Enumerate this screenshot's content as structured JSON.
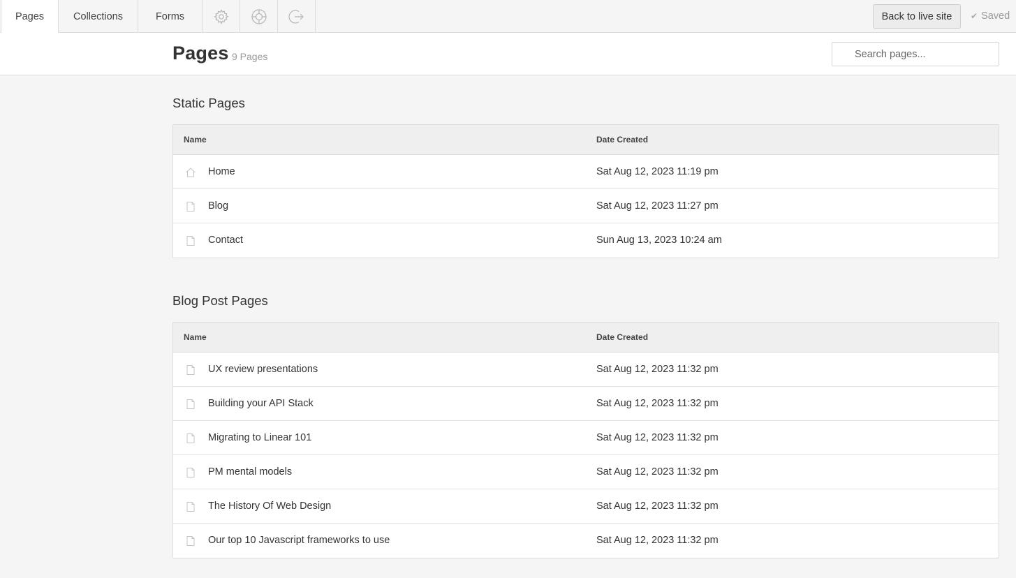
{
  "topbar": {
    "tabs": [
      {
        "label": "Pages",
        "active": true
      },
      {
        "label": "Collections",
        "active": false
      },
      {
        "label": "Forms",
        "active": false
      }
    ],
    "icon_tabs": [
      "gear-icon",
      "lifebuoy-icon",
      "logout-icon"
    ],
    "back_button": "Back to live site",
    "saved_label": "Saved"
  },
  "header": {
    "title": "Pages",
    "count": "9 Pages",
    "search_placeholder": "Search pages..."
  },
  "static_pages": {
    "title": "Static Pages",
    "col_name": "Name",
    "col_date": "Date Created",
    "rows": [
      {
        "name": "Home",
        "date": "Sat Aug 12, 2023 11:19 pm",
        "icon": "home-icon"
      },
      {
        "name": "Blog",
        "date": "Sat Aug 12, 2023 11:27 pm",
        "icon": "page-icon"
      },
      {
        "name": "Contact",
        "date": "Sun Aug 13, 2023 10:24 am",
        "icon": "page-icon"
      }
    ]
  },
  "blog_pages": {
    "title": "Blog Post Pages",
    "col_name": "Name",
    "col_date": "Date Created",
    "rows": [
      {
        "name": "UX review presentations",
        "date": "Sat Aug 12, 2023 11:32 pm",
        "icon": "page-icon"
      },
      {
        "name": "Building your API Stack",
        "date": "Sat Aug 12, 2023 11:32 pm",
        "icon": "page-icon"
      },
      {
        "name": "Migrating to Linear 101",
        "date": "Sat Aug 12, 2023 11:32 pm",
        "icon": "page-icon"
      },
      {
        "name": "PM mental models",
        "date": "Sat Aug 12, 2023 11:32 pm",
        "icon": "page-icon"
      },
      {
        "name": "The History Of Web Design",
        "date": "Sat Aug 12, 2023 11:32 pm",
        "icon": "page-icon"
      },
      {
        "name": "Our top 10 Javascript frameworks to use",
        "date": "Sat Aug 12, 2023 11:32 pm",
        "icon": "page-icon"
      }
    ]
  }
}
